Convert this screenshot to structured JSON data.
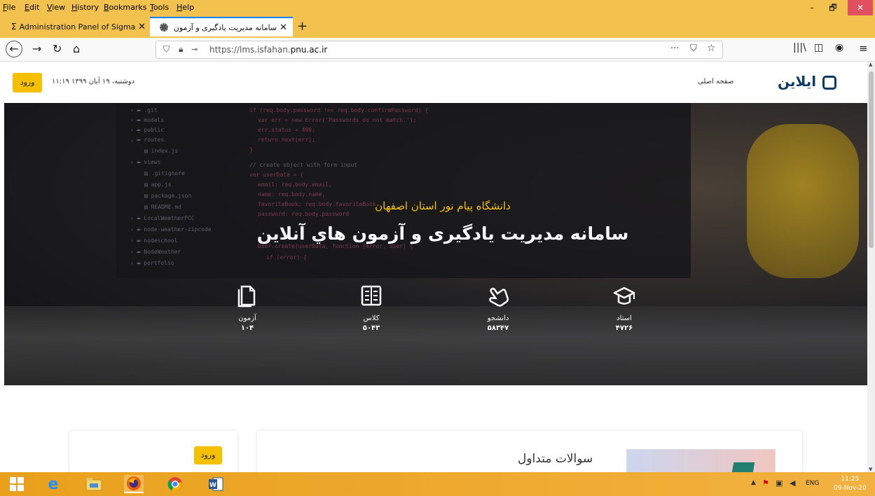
{
  "browser": {
    "menu": [
      "File",
      "Edit",
      "View",
      "History",
      "Bookmarks",
      "Tools",
      "Help"
    ],
    "window_controls": {
      "minimize": "–",
      "restore": "🗗",
      "close": "✕"
    },
    "tabs": [
      {
        "title": "Administration Panel of Sigma",
        "active": false
      },
      {
        "title": "سامانه مدیریت یادگیری و آزمون",
        "active": true
      }
    ],
    "new_tab": "+",
    "url_prefix": "https://lms.isfahan.",
    "url_domain": "pnu.ac.ir",
    "page_actions": "···"
  },
  "site": {
    "logo_text": "ايلاين",
    "home_link": "صفحه اصلی",
    "date_text": "دوشنبه، ۱۹ آبان ۱۳۹۹ ۱۱:۱۹",
    "login_label": "ورود"
  },
  "hero": {
    "subtitle": "دانشگاه پیام نور استان اصفهان",
    "title": "سامانه مدیریت یادگیری و آزمون هاي آنلاین",
    "stats": [
      {
        "label": "آزمون",
        "value": "۱۰۴",
        "icon": "files-icon"
      },
      {
        "label": "کلاس",
        "value": "۵۰۴۳",
        "icon": "book-icon"
      },
      {
        "label": "دانشجو",
        "value": "۵۸۳۴۷",
        "icon": "hand-icon"
      },
      {
        "label": "استاد",
        "value": "۴۷۲۶",
        "icon": "graduation-cap-icon"
      }
    ]
  },
  "cards": {
    "login_label": "ورود",
    "faq_title": "سوالات متداول"
  },
  "taskbar": {
    "lang": "ENG",
    "time": "11:25",
    "date": "09-Nov-20"
  },
  "colors": {
    "accent": "#f5c000",
    "chrome": "#f2c14e",
    "hero_bg": "#1c1c1f",
    "logo": "#0d3b66"
  }
}
